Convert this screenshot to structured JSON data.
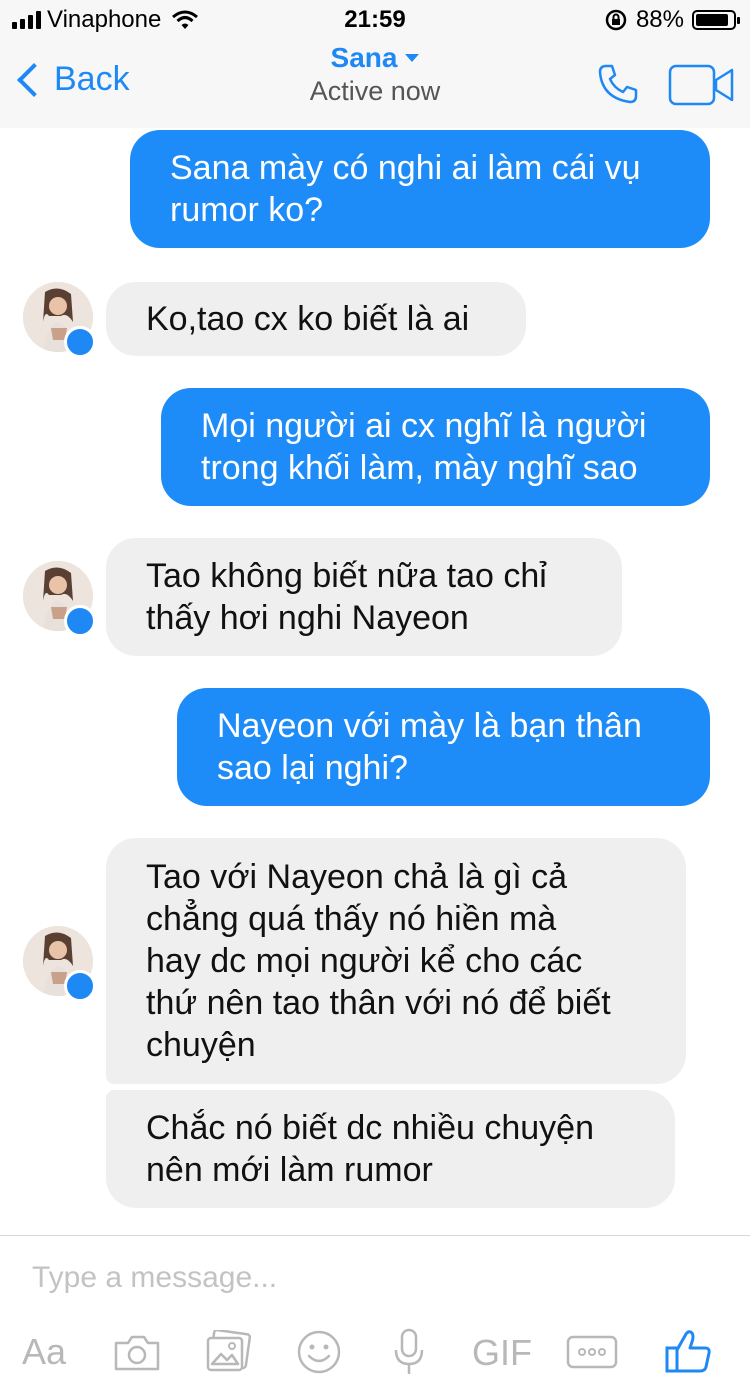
{
  "status_bar": {
    "carrier": "Vinaphone",
    "time": "21:59",
    "battery_percent": "88%",
    "battery_level": 0.88
  },
  "nav": {
    "back_label": "Back",
    "contact_name": "Sana",
    "presence": "Active now"
  },
  "messages": [
    {
      "direction": "outgoing",
      "lines": [
        "Sana mày có nghi ai làm cái vụ",
        "rumor ko?"
      ]
    },
    {
      "direction": "incoming",
      "lines": [
        "Ko,tao cx ko biết là ai"
      ]
    },
    {
      "direction": "outgoing",
      "lines": [
        "Mọi người ai cx nghĩ là người",
        "trong khối làm, mày nghĩ sao"
      ]
    },
    {
      "direction": "incoming",
      "lines": [
        "Tao không biết nữa tao chỉ",
        "thấy hơi nghi Nayeon"
      ]
    },
    {
      "direction": "outgoing",
      "lines": [
        "Nayeon với mày là bạn thân",
        "sao lại nghi?"
      ]
    },
    {
      "direction": "incoming",
      "lines": [
        "Tao với Nayeon chả là gì cả",
        "chẳng quá thấy nó hiền mà",
        "hay dc mọi người kể cho các",
        "thứ nên tao thân với nó để biết",
        "chuyện"
      ]
    },
    {
      "direction": "incoming",
      "lines": [
        "Chắc nó biết dc nhiều chuyện",
        "nên mới làm rumor"
      ]
    }
  ],
  "composer": {
    "placeholder": "Type a message...",
    "value": ""
  },
  "toolbar": {
    "text_label": "Aa",
    "gif_label": "GIF",
    "icons": [
      "text-format-icon",
      "camera-icon",
      "gallery-icon",
      "emoji-icon",
      "microphone-icon",
      "gif-icon",
      "more-icon",
      "thumbs-up-icon"
    ]
  },
  "colors": {
    "accent": "#1e88f5",
    "outgoing_bubble": "#1e8cf8",
    "incoming_bubble": "#efefef",
    "toolbar_icon": "#b8b8b8"
  }
}
